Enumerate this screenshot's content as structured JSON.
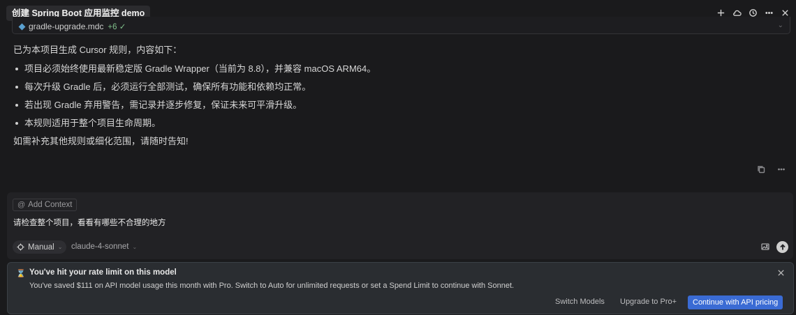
{
  "header": {
    "title": "创建 Spring Boot 应用监控 demo",
    "icons": [
      "plus-icon",
      "cloud-icon",
      "history-icon",
      "more-icon",
      "close-icon"
    ]
  },
  "file_card": {
    "filename": "gradle-upgrade.mdc",
    "more": "+6 ✓"
  },
  "message": {
    "intro": "已为本项目生成 Cursor 规则，内容如下：",
    "bullets": [
      "项目必须始终使用最新稳定版 Gradle Wrapper（当前为 8.8），并兼容 macOS ARM64。",
      "每次升级 Gradle 后，必须运行全部测试，确保所有功能和依赖均正常。",
      "若出现 Gradle 弃用警告，需记录并逐步修复，保证未来可平滑升级。",
      "本规则适用于整个项目生命周期。"
    ],
    "outro": "如需补充其他规则或细化范围，请随时告知!"
  },
  "composer": {
    "add_context": "Add Context",
    "prompt_text": "请检查整个项目，看看有哪些不合理的地方",
    "mode": "Manual",
    "model": "claude-4-sonnet"
  },
  "banner": {
    "title": "You've hit your rate limit on this model",
    "text": "You've saved $111 on API model usage this month with Pro. Switch to Auto for unlimited requests or set a Spend Limit to continue with Sonnet.",
    "switch_models": "Switch Models",
    "upgrade": "Upgrade to Pro+",
    "continue": "Continue with API pricing"
  },
  "colors": {
    "background": "#1a1a1c",
    "accent": "#3a6bd4",
    "banner_bg": "#2a2d31"
  }
}
